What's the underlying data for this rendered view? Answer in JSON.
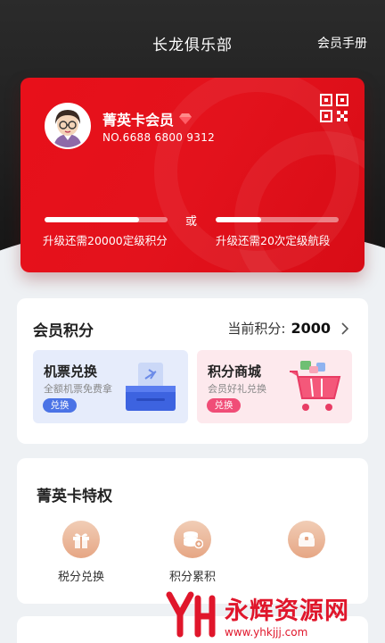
{
  "header": {
    "title": "长龙俱乐部",
    "manual_label": "会员手册"
  },
  "card": {
    "tier_name": "菁英卡会员",
    "member_no": "NO.6688 6800 9312",
    "or_label": "或",
    "progress_points": {
      "text": "升级还需20000定级积分",
      "fraction": 0.77
    },
    "progress_segments": {
      "text": "升级还需20次定级航段",
      "fraction": 0.37
    },
    "accent": "#e3121c"
  },
  "points": {
    "title": "会员积分",
    "current_label": "当前积分:",
    "current_value": "2000",
    "tiles": [
      {
        "title": "机票兑换",
        "subtitle": "全额机票免费拿",
        "button": "兑换",
        "button_color": "#4b73e6",
        "bg": "#e6ecfb"
      },
      {
        "title": "积分商城",
        "subtitle": "会员好礼兑换",
        "button": "兑换",
        "button_color": "#f04d77",
        "bg": "#fde9ed"
      }
    ]
  },
  "privileges": {
    "title": "菁英卡特权",
    "items": [
      {
        "label": "税分兑换",
        "icon": "gift-icon"
      },
      {
        "label": "积分累积",
        "icon": "coins-icon"
      },
      {
        "label": "",
        "icon": "bag-icon"
      }
    ]
  },
  "watermark": {
    "brand": "永辉资源网",
    "url": "www.yhkjjj.com"
  }
}
